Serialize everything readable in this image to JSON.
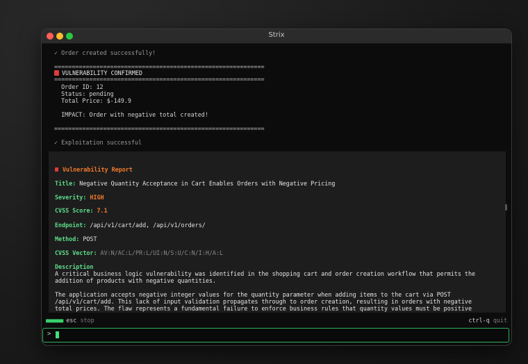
{
  "window": {
    "title": "Strix"
  },
  "terminal": {
    "order_created": "✓ Order created successfully!",
    "rule": "============================================================",
    "vuln_confirmed": "VULNERABILITY CONFIRMED",
    "order_id": "  Order ID: 12",
    "status": "  Status: pending",
    "total_price": "  Total Price: $-149.9",
    "impact": "  IMPACT: Order with negative total created!",
    "exploitation": "✓ Exploitation successful"
  },
  "report": {
    "heading": "Vulnerability Report",
    "title_label": "Title:",
    "title_value": " Negative Quantity Acceptance in Cart Enables Orders with Negative Pricing",
    "severity_label": "Severity:",
    "severity_value": " HIGH",
    "cvss_label": "CVSS Score:",
    "cvss_value": " 7.1",
    "endpoint_label": "Endpoint:",
    "endpoint_value": " /api/v1/cart/add, /api/v1/orders/",
    "method_label": "Method:",
    "method_value": " POST",
    "vector_label": "CVSS Vector:",
    "vector_value": " AV:N/AC:L/PR:L/UI:N/S:U/C:N/I:H/A:L",
    "description_label": "Description",
    "description_p1": "A critical business logic vulnerability was identified in the shopping cart and order creation workflow that permits the addition of products with negative quantities.",
    "description_p2": "The application accepts negative integer values for the quantity parameter when adding items to the cart via POST /api/v1/cart/add. This lack of input validation propagates through to order creation, resulting in orders with negative total prices. The flaw represents a fundamental failure to enforce business rules that quantity values must be positive integers."
  },
  "status": {
    "dots": "■■■■■■",
    "esc_key": "esc",
    "esc_action": " stop",
    "quit_key": "ctrl-q",
    "quit_action": " quit"
  },
  "input": {
    "prompt": ">"
  },
  "colors": {
    "accent_green": "#2fb45e",
    "severity_orange": "#f07a2c",
    "label_green": "#5fdc8a"
  }
}
